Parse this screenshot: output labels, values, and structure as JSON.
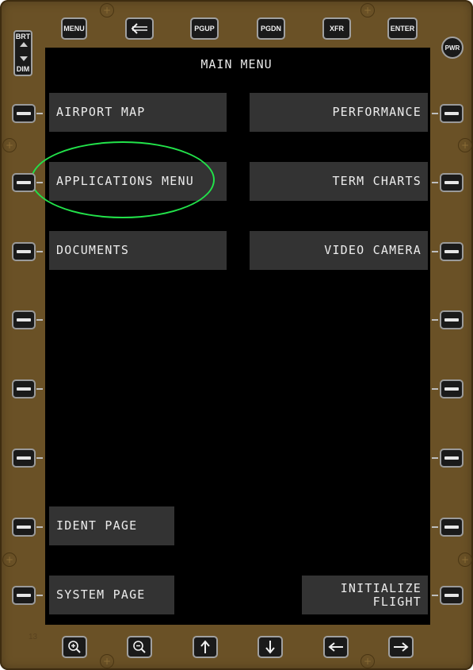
{
  "screen": {
    "title": "MAIN MENU"
  },
  "top_keys": [
    {
      "name": "menu-key",
      "label": "MENU"
    },
    {
      "name": "back-key",
      "label": "",
      "icon": "back-arrow-icon"
    },
    {
      "name": "pgup-key",
      "label": "PGUP"
    },
    {
      "name": "pgdn-key",
      "label": "PGDN"
    },
    {
      "name": "xfr-key",
      "label": "XFR"
    },
    {
      "name": "enter-key",
      "label": "ENTER"
    }
  ],
  "brightness": {
    "brt_label": "BRT",
    "dim_label": "DIM"
  },
  "power": {
    "label": "PWR"
  },
  "left_menu": {
    "airport_map": "AIRPORT MAP",
    "applications_menu": "APPLICATIONS MENU",
    "documents": "DOCUMENTS",
    "ident_page": "IDENT PAGE",
    "system_page": "SYSTEM PAGE"
  },
  "right_menu": {
    "performance": "PERFORMANCE",
    "term_charts": "TERM CHARTS",
    "video_camera": "VIDEO CAMERA",
    "initialize_flight": "INITIALIZE\nFLIGHT"
  },
  "bottom_keys": [
    {
      "name": "zoom-in-key",
      "icon": "zoom-in-icon"
    },
    {
      "name": "zoom-out-key",
      "icon": "zoom-out-icon"
    },
    {
      "name": "scroll-up-key",
      "icon": "arrow-up-icon"
    },
    {
      "name": "scroll-down-key",
      "icon": "arrow-down-icon"
    },
    {
      "name": "scroll-left-key",
      "icon": "arrow-left-icon"
    },
    {
      "name": "scroll-right-key",
      "icon": "arrow-right-icon"
    }
  ],
  "bezel_marking": "13",
  "colors": {
    "bezel": "#6a5126",
    "screen": "#000000",
    "button": "#333333",
    "text": "#ececec",
    "highlight": "#22e24a"
  }
}
